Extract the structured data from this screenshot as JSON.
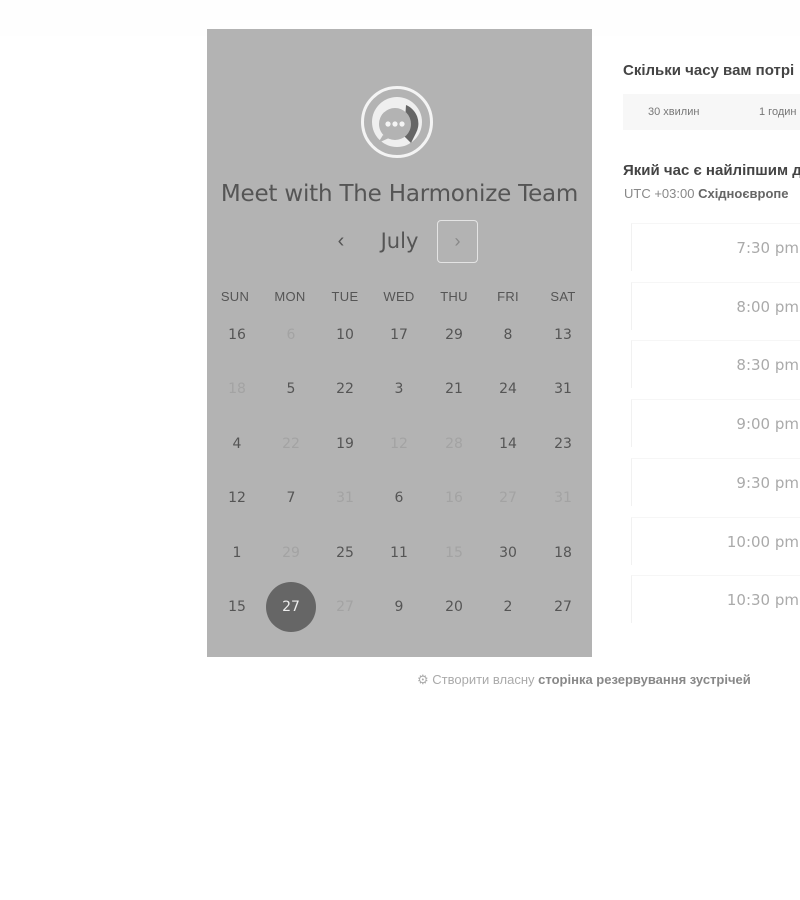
{
  "calendar": {
    "title": "Meet with The Harmonize Team",
    "month": "July",
    "prev_icon": "chevron-left-icon",
    "next_icon": "chevron-right-icon",
    "weekdays": [
      "SUN",
      "MON",
      "TUE",
      "WED",
      "THU",
      "FRI",
      "SAT"
    ],
    "rows": [
      [
        {
          "d": "16",
          "s": "enabled"
        },
        {
          "d": "6",
          "s": "disabled"
        },
        {
          "d": "10",
          "s": "enabled"
        },
        {
          "d": "17",
          "s": "enabled"
        },
        {
          "d": "29",
          "s": "enabled"
        },
        {
          "d": "8",
          "s": "enabled"
        },
        {
          "d": "13",
          "s": "enabled"
        }
      ],
      [
        {
          "d": "18",
          "s": "disabled"
        },
        {
          "d": "5",
          "s": "enabled"
        },
        {
          "d": "22",
          "s": "enabled"
        },
        {
          "d": "3",
          "s": "enabled"
        },
        {
          "d": "21",
          "s": "enabled"
        },
        {
          "d": "24",
          "s": "enabled"
        },
        {
          "d": "31",
          "s": "enabled"
        }
      ],
      [
        {
          "d": "4",
          "s": "enabled"
        },
        {
          "d": "22",
          "s": "disabled"
        },
        {
          "d": "19",
          "s": "enabled"
        },
        {
          "d": "12",
          "s": "disabled"
        },
        {
          "d": "28",
          "s": "disabled"
        },
        {
          "d": "14",
          "s": "enabled"
        },
        {
          "d": "23",
          "s": "enabled"
        }
      ],
      [
        {
          "d": "12",
          "s": "enabled"
        },
        {
          "d": "7",
          "s": "enabled"
        },
        {
          "d": "31",
          "s": "disabled"
        },
        {
          "d": "6",
          "s": "enabled"
        },
        {
          "d": "16",
          "s": "disabled"
        },
        {
          "d": "27",
          "s": "disabled"
        },
        {
          "d": "31",
          "s": "disabled"
        }
      ],
      [
        {
          "d": "1",
          "s": "enabled"
        },
        {
          "d": "29",
          "s": "disabled"
        },
        {
          "d": "25",
          "s": "enabled"
        },
        {
          "d": "11",
          "s": "enabled"
        },
        {
          "d": "15",
          "s": "disabled"
        },
        {
          "d": "30",
          "s": "enabled"
        },
        {
          "d": "18",
          "s": "enabled"
        }
      ],
      [
        {
          "d": "15",
          "s": "enabled"
        },
        {
          "d": "27",
          "s": "selected"
        },
        {
          "d": "27",
          "s": "disabled"
        },
        {
          "d": "9",
          "s": "enabled"
        },
        {
          "d": "20",
          "s": "enabled"
        },
        {
          "d": "2",
          "s": "enabled"
        },
        {
          "d": "27",
          "s": "enabled"
        }
      ]
    ]
  },
  "duration": {
    "title": "Скільки часу вам потрі",
    "options": [
      "30 хвилин",
      "1 годин"
    ]
  },
  "time": {
    "title": "Який час є найліпшим д",
    "tz_offset": "UTC +03:00",
    "tz_name": "Східноєвропе",
    "slots": [
      "7:30 pm",
      "8:00 pm",
      "8:30 pm",
      "9:00 pm",
      "9:30 pm",
      "10:00 pm",
      "10:30 pm"
    ]
  },
  "footer": {
    "icon": "hubspot-sprocket-icon",
    "text_plain": "Створити власну",
    "text_bold": "сторінка резервування зустрічей"
  }
}
